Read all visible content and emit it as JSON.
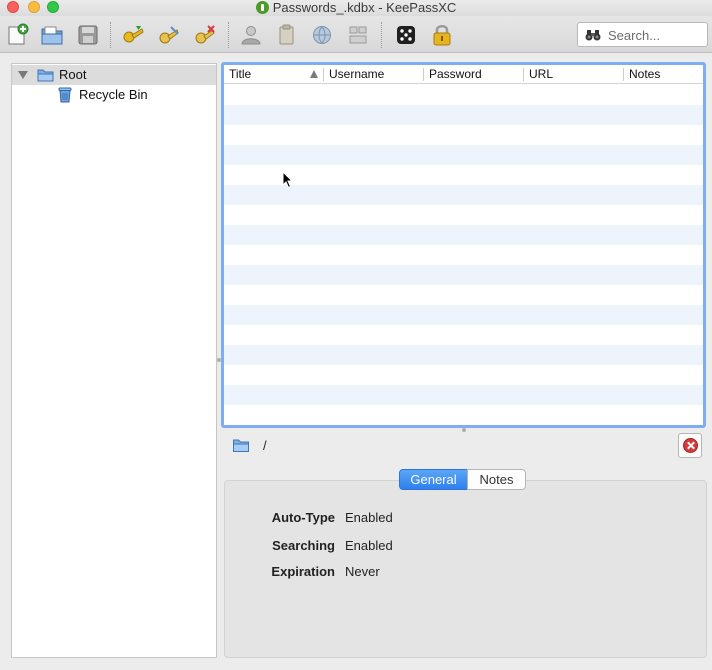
{
  "window": {
    "title": "Passwords_.kdbx - KeePassXC"
  },
  "toolbar": {
    "buttons": [
      {
        "icon": "new-database-icon",
        "tooltip": ""
      },
      {
        "icon": "open-database-icon",
        "tooltip": ""
      },
      {
        "icon": "save-database-icon",
        "tooltip": ""
      },
      {
        "icon": "add-entry-icon",
        "tooltip": ""
      },
      {
        "icon": "edit-entry-icon",
        "tooltip": ""
      },
      {
        "icon": "delete-entry-icon",
        "tooltip": ""
      },
      {
        "icon": "copy-username-icon",
        "tooltip": ""
      },
      {
        "icon": "copy-password-icon",
        "tooltip": ""
      },
      {
        "icon": "open-url-icon",
        "tooltip": ""
      },
      {
        "icon": "auto-type-icon",
        "tooltip": ""
      },
      {
        "icon": "password-generator-dice-icon",
        "tooltip": ""
      },
      {
        "icon": "lock-database-icon",
        "tooltip": ""
      }
    ],
    "search_placeholder": "Search..."
  },
  "tree": {
    "items": [
      {
        "label": "Root",
        "icon": "folder-icon",
        "expanded": true,
        "selected": true
      },
      {
        "label": "Recycle Bin",
        "icon": "recycle-bin-icon",
        "expanded": false,
        "selected": false
      }
    ]
  },
  "table": {
    "columns": [
      "Title",
      "Username",
      "Password",
      "URL",
      "Notes"
    ],
    "sorted_column": "Title",
    "sort_direction": "ascending",
    "rows": []
  },
  "group_path": {
    "icon": "folder-icon",
    "text": "/"
  },
  "details": {
    "tabs": [
      "General",
      "Notes"
    ],
    "active_tab": "General",
    "fields": [
      {
        "key": "Auto-Type",
        "value": "Enabled"
      },
      {
        "key": "Searching",
        "value": "Enabled"
      },
      {
        "key": "Expiration",
        "value": "Never"
      }
    ]
  },
  "colors": {
    "selection_accent": "#2f80ee",
    "table_focus_border": "#7eaef0",
    "alt_row": "#eef4fc"
  }
}
